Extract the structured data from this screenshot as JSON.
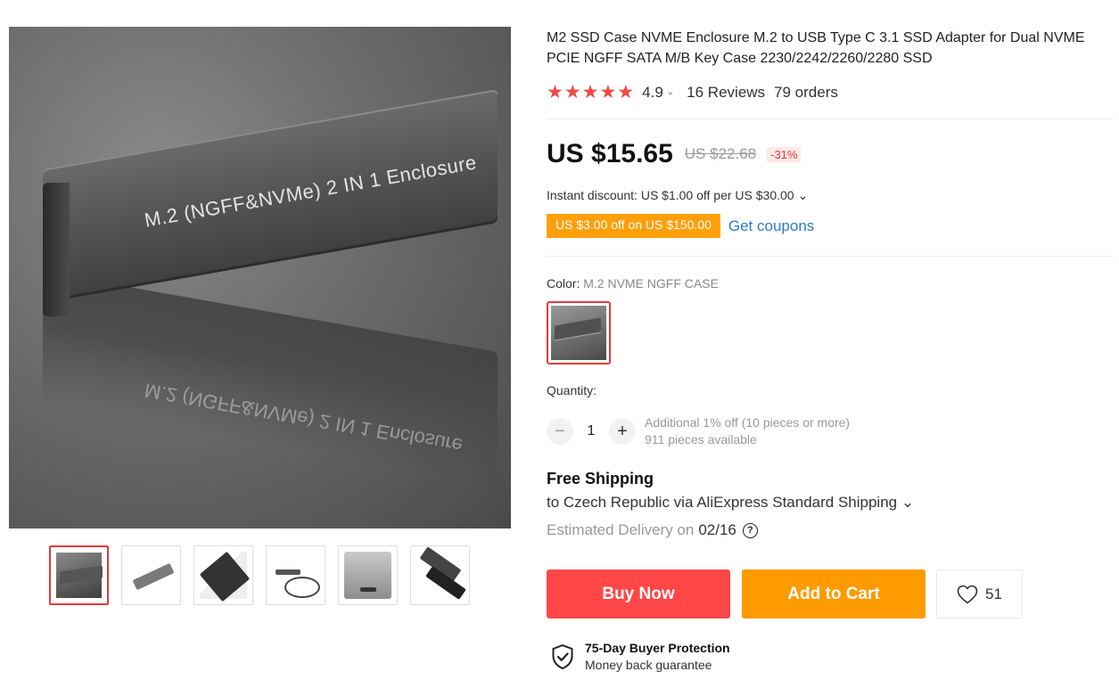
{
  "product": {
    "title": "M2 SSD Case NVME Enclosure M.2 to USB Type C 3.1 SSD Adapter for Dual NVME PCIE NGFF SATA M/B Key Case 2230/2242/2260/2280 SSD",
    "image_caption": "M.2 (NGFF&NVMe) 2 IN 1 Enclosure",
    "image_end_label": "NGFF"
  },
  "gallery": {
    "thumbnails": [
      "thumb-1",
      "thumb-2",
      "thumb-3",
      "thumb-4",
      "thumb-5",
      "thumb-6"
    ],
    "active_index": 0
  },
  "rating": {
    "stars": "★★★★★",
    "value": "4.9",
    "caret": "⌄",
    "reviews": "16 Reviews",
    "orders": "79 orders"
  },
  "price": {
    "current": "US $15.65",
    "original": "US $22.68",
    "discount": "-31%"
  },
  "instant_discount": "Instant discount: US $1.00 off per US $30.00 ⌄",
  "coupon": {
    "tag": "US $3.00 off on US $150.00",
    "link": "Get coupons"
  },
  "color": {
    "label": "Color: ",
    "selected": "M.2 NVME NGFF CASE"
  },
  "quantity": {
    "label": "Quantity:",
    "minus": "−",
    "value": "1",
    "plus": "+",
    "additional": "Additional 1% off (10 pieces or more)",
    "available": "911 pieces available"
  },
  "shipping": {
    "title": "Free Shipping",
    "to": "to Czech Republic via AliExpress Standard Shipping ⌄",
    "delivery_label": "Estimated Delivery on",
    "delivery_date": "02/16",
    "help": "?"
  },
  "actions": {
    "buy_now": "Buy Now",
    "add_to_cart": "Add to Cart",
    "wishlist_count": "51"
  },
  "protection": {
    "title": "75-Day Buyer Protection",
    "subtitle": "Money back guarantee"
  },
  "colors": {
    "accent_red": "#ff4747",
    "accent_orange": "#ff9a00",
    "star_red": "#f04a44",
    "link_blue": "#2e7bc4"
  }
}
